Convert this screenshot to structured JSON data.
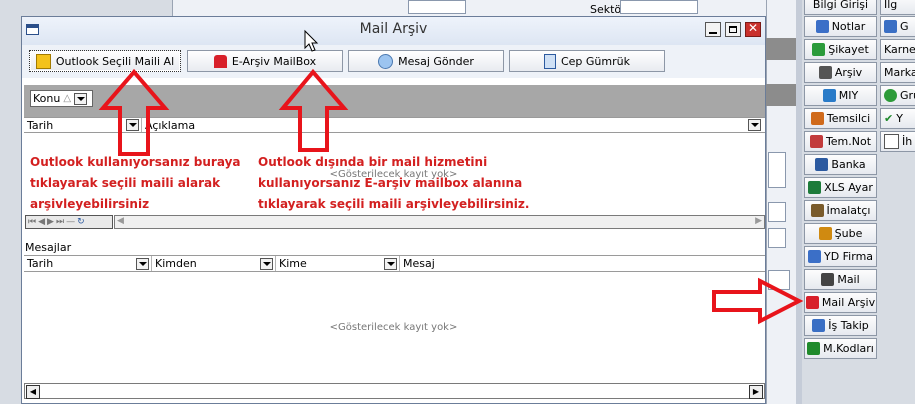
{
  "background": {
    "top_buttons": [
      "Bilgi Girişi",
      "İlg"
    ],
    "sektor_label": "Sektör",
    "side_buttons": [
      {
        "label": "Notlar",
        "icon": "note-icon"
      },
      {
        "label": "Şikayet",
        "icon": "complaint-icon"
      },
      {
        "label": "Arşiv",
        "icon": "archive-icon"
      },
      {
        "label": "MIY",
        "icon": "globe-icon"
      },
      {
        "label": "Temsilci",
        "icon": "people-icon"
      },
      {
        "label": "Tem.Not",
        "icon": "people-note-icon"
      },
      {
        "label": "Banka",
        "icon": "bank-icon"
      },
      {
        "label": "XLS Ayar",
        "icon": "excel-icon"
      },
      {
        "label": "İmalatçı",
        "icon": "factory-icon"
      },
      {
        "label": "Şube",
        "icon": "truck-icon"
      },
      {
        "label": "YD Firma",
        "icon": "firm-icon"
      },
      {
        "label": "Mail",
        "icon": "mail-icon"
      },
      {
        "label": "Mail Arşiv",
        "icon": "mail-archive-icon"
      },
      {
        "label": "İş Takip",
        "icon": "task-icon"
      },
      {
        "label": "M.Kodları",
        "icon": "codes-icon"
      }
    ],
    "far_buttons": [
      "G",
      "Karne",
      "Marka",
      "Gru",
      "Y",
      "İh"
    ]
  },
  "window": {
    "title": "Mail Arşiv",
    "toolbar": {
      "outlook": "Outlook Seçili Maili Al",
      "earsiv": "E-Arşiv MailBox",
      "mesaj": "Mesaj Gönder",
      "cep": "Cep Gümrük"
    },
    "group_by": {
      "value": "Konu",
      "sort_glyph": "△"
    },
    "archive_grid": {
      "columns": [
        "Tarih",
        "Açıklama"
      ],
      "empty_text": "<Gösterilecek kayıt yok>"
    },
    "messages": {
      "label": "Mesajlar",
      "columns": [
        "Tarih",
        "Kimden",
        "Kime",
        "Mesaj"
      ],
      "empty_text": "<Gösterilecek kayıt yok>"
    }
  },
  "annotations": {
    "left": [
      "Outlook kullanıyorsanız buraya",
      "tıklayarak seçili maili alarak",
      "arşivleyebilirsiniz"
    ],
    "right": [
      "Outlook dışında bir mail hizmetini",
      "kullanıyorsanız E-arşiv mailbox alanına",
      "tıklayarak seçili maili arşivleyebilirsiniz."
    ]
  },
  "colors": {
    "arrow": "#e8141b",
    "annotation_text": "#d32020"
  }
}
